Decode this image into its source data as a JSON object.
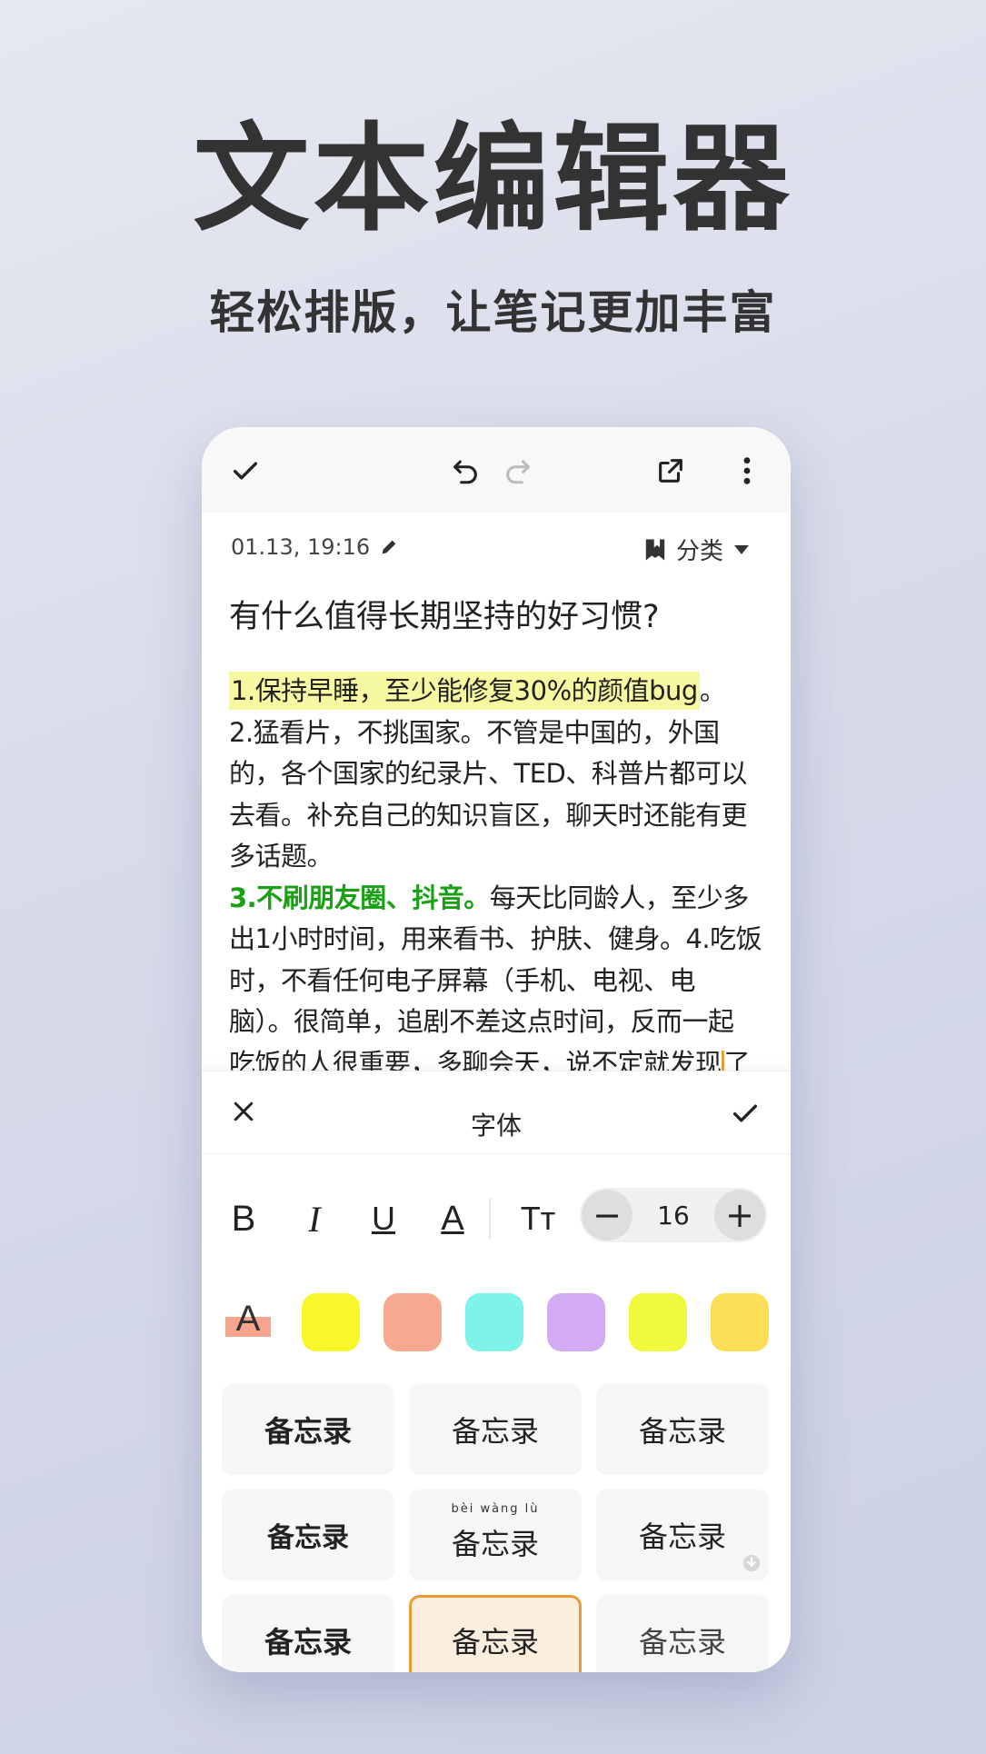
{
  "hero": {
    "title": "文本编辑器",
    "subtitle": "轻松排版，让笔记更加丰富"
  },
  "toolbar": {
    "done_icon": "check-icon",
    "undo_icon": "undo-icon",
    "redo_icon": "redo-icon",
    "share_icon": "share-icon",
    "more_icon": "more-vertical-icon"
  },
  "note": {
    "timestamp": "01.13, 19:16",
    "category_label": "分类",
    "title": "有什么值得长期坚持的好习惯?",
    "body": {
      "line1_highlight": "1.保持早睡，至少能修复30%的颜值bug",
      "line1_tail": "。",
      "line2": "2.猛看片，不挑国家。不管是中国的，外国",
      "line3": "的，各个国家的纪录片、TED、科普片都可以",
      "line4": "去看。补充自己的知识盲区，聊天时还能有更",
      "line5": "多话题。",
      "line6_green": "3.不刷朋友圈、抖音。",
      "line6_tail": "每天比同龄人，至少多",
      "line7": "出1小时时间，用来看书、护肤、健身。4.吃饭",
      "line8": "时，不看任何电子屏幕（手机、电视、电",
      "line9": "脑）。很简单，追剧不差这点时间，反而一起",
      "line10_head": "吃饭的人很重要，多聊会天，说不定就发现",
      "line10_tail": "了"
    }
  },
  "font_panel": {
    "title": "字体",
    "size_value": "16",
    "minus_label": "−",
    "plus_label": "+",
    "bold_label": "B",
    "italic_label": "I",
    "underline_label": "U",
    "color_label": "A",
    "size_label": "Tт",
    "highlight_label": "A",
    "colors": {
      "accent": "#e79c38",
      "green_text": "#19a015",
      "highlight_row": [
        "#faf62c",
        "#f7a98f",
        "#7ef3e9",
        "#d2abf4",
        "#f1f93e",
        "#fddf57"
      ]
    },
    "font_samples": [
      "备忘录",
      "备忘录",
      "备忘录",
      "备忘录",
      "备忘录",
      "备忘录",
      "备忘录",
      "备忘录",
      "备忘录"
    ],
    "pinyin": "bèi wàng lù"
  }
}
